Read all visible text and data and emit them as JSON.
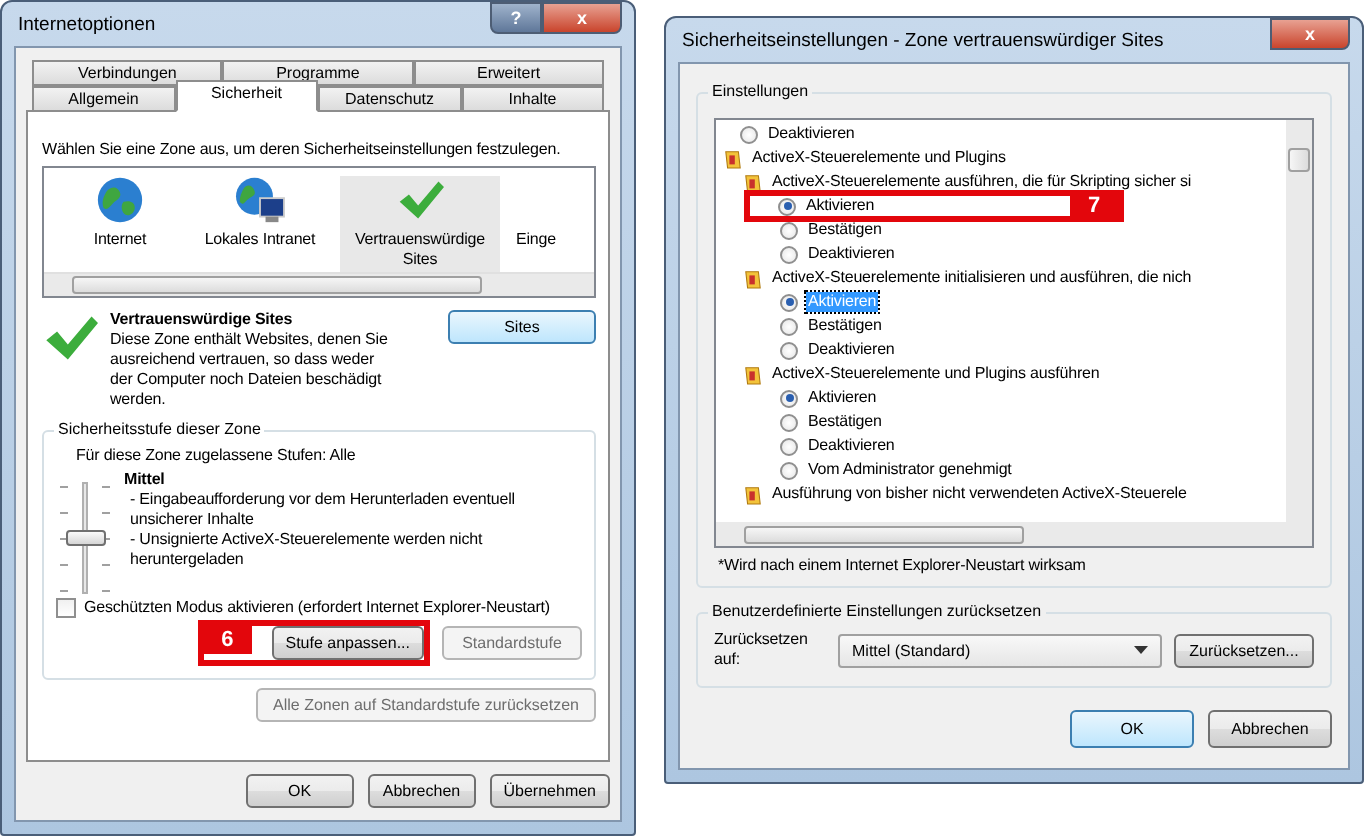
{
  "internet_options": {
    "title": "Internetoptionen",
    "title_buttons": [
      "?",
      "x"
    ],
    "tab_rows": [
      [
        {
          "label": "Verbindungen",
          "selected": false
        },
        {
          "label": "Programme",
          "selected": false
        },
        {
          "label": "Erweitert",
          "selected": false
        }
      ],
      [
        {
          "label": "Allgemein",
          "selected": false
        },
        {
          "label": "Sicherheit",
          "selected": true
        },
        {
          "label": "Datenschutz",
          "selected": false
        },
        {
          "label": "Inhalte",
          "selected": false
        }
      ]
    ],
    "instruction": "Wählen Sie eine Zone aus, um deren Sicherheitseinstellungen festzulegen.",
    "zones": [
      {
        "label": "Internet",
        "kind": "globe",
        "selected": false
      },
      {
        "label": "Lokales Intranet",
        "kind": "intranet",
        "selected": false
      },
      {
        "label": "Vertrauenswürdige Sites",
        "kind": "check",
        "selected": true
      },
      {
        "label": "Einge",
        "kind": "none",
        "selected": false
      }
    ],
    "zone_info": {
      "title": "Vertrauenswürdige Sites",
      "text": "Diese Zone enthält Websites, denen Sie ausreichend vertrauen, so dass weder der Computer noch Dateien beschädigt werden.",
      "button": "Sites"
    },
    "level_group": {
      "legend": "Sicherheitsstufe dieser Zone",
      "allowed": "Für diese Zone zugelassene Stufen: Alle",
      "level_name": "Mittel",
      "bullets": [
        "- Eingabeaufforderung vor dem Herunterladen eventuell unsicherer Inhalte",
        "- Unsignierte ActiveX-Steuerelemente werden nicht heruntergeladen"
      ],
      "slider": {
        "level": 0.5
      },
      "protected_mode": {
        "label": "Geschützten Modus aktivieren (erfordert Internet Explorer-Neustart)",
        "checked": false
      },
      "buttons": [
        {
          "label": "Stufe anpassen...",
          "disabled": false
        },
        {
          "label": "Standardstufe",
          "disabled": true
        }
      ]
    },
    "reset_all": {
      "label": "Alle Zonen auf Standardstufe zurücksetzen",
      "disabled": true
    },
    "footer_buttons": [
      "OK",
      "Abbrechen",
      "Übernehmen"
    ],
    "callout": "6"
  },
  "security_settings": {
    "title": "Sicherheitseinstellungen - Zone vertrauenswürdiger Sites",
    "close_button": "x",
    "settings_legend": "Einstellungen",
    "tree": [
      {
        "kind": "option",
        "label": "Deaktivieren",
        "selected": false
      },
      {
        "kind": "category",
        "label": "ActiveX-Steuerelemente und Plugins",
        "children": [
          {
            "kind": "setting",
            "label": "ActiveX-Steuerelemente ausführen, die für Skripting sicher si",
            "children": [
              {
                "kind": "option",
                "label": "Aktivieren",
                "selected": true,
                "callout": "7"
              },
              {
                "kind": "option",
                "label": "Bestätigen",
                "selected": false
              },
              {
                "kind": "option",
                "label": "Deaktivieren",
                "selected": false
              }
            ]
          },
          {
            "kind": "setting",
            "label": "ActiveX-Steuerelemente initialisieren und ausführen, die nich",
            "children": [
              {
                "kind": "option",
                "label": "Aktivieren",
                "selected": true,
                "focused": true
              },
              {
                "kind": "option",
                "label": "Bestätigen",
                "selected": false
              },
              {
                "kind": "option",
                "label": "Deaktivieren",
                "selected": false
              }
            ]
          },
          {
            "kind": "setting",
            "label": "ActiveX-Steuerelemente und Plugins ausführen",
            "children": [
              {
                "kind": "option",
                "label": "Aktivieren",
                "selected": true
              },
              {
                "kind": "option",
                "label": "Bestätigen",
                "selected": false
              },
              {
                "kind": "option",
                "label": "Deaktivieren",
                "selected": false
              },
              {
                "kind": "option",
                "label": "Vom Administrator genehmigt",
                "selected": false
              }
            ]
          },
          {
            "kind": "setting",
            "label": "Ausführung von bisher nicht verwendeten ActiveX-Steuerele"
          }
        ]
      }
    ],
    "note": "*Wird nach einem Internet Explorer-Neustart wirksam",
    "reset_group": {
      "legend": "Benutzerdefinierte Einstellungen zurücksetzen",
      "label": "Zurücksetzen auf:",
      "select_value": "Mittel (Standard)",
      "button": "Zurücksetzen..."
    },
    "footer_buttons": [
      "OK",
      "Abbrechen"
    ]
  }
}
